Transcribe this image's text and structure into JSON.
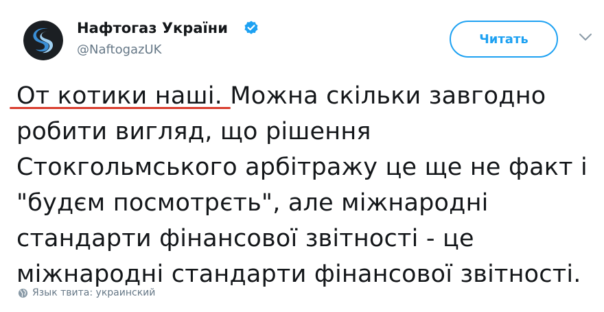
{
  "account": {
    "display_name": "Нафтогаз України",
    "handle": "@NaftogazUK",
    "verified": true
  },
  "actions": {
    "follow_label": "Читать",
    "menu_icon": "chevron-down-icon"
  },
  "tweet": {
    "lines": [
      "От котики наші. Можна скільки завгодно",
      "робити вигляд, що рішення",
      "Стокгольмського арбітражу це ще не факт і",
      "\"будєм посмотрєть\", але міжнародні",
      "стандарти фінансової звітності - це",
      "міжнародні стандарти фінансової звітності."
    ],
    "language_label": "Язык твита: украинский"
  },
  "colors": {
    "accent": "#1da1f2",
    "text": "#14171a",
    "muted": "#657786",
    "annotation": "#d93a2b"
  },
  "icons": {
    "avatar": "naftogaz-logo",
    "verified": "verified-badge-icon",
    "language": "globe-icon"
  }
}
